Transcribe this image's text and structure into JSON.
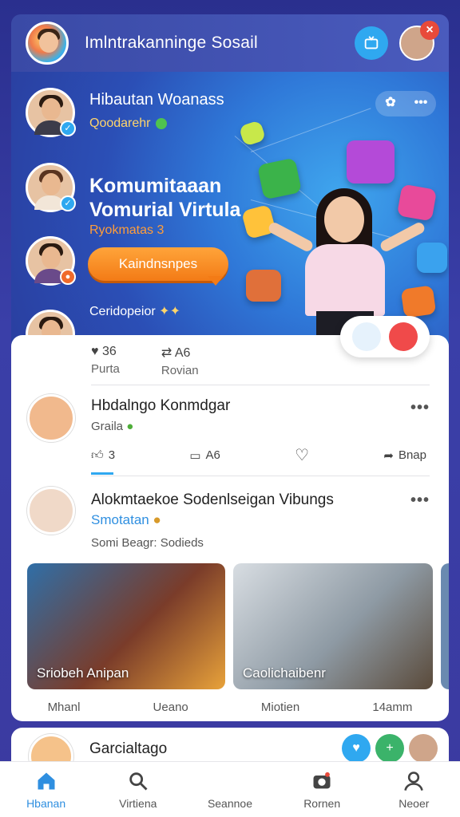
{
  "header": {
    "title": "Imlntrakanninge Sosail",
    "tv_icon": "tv-icon",
    "close_icon": "close-icon"
  },
  "hero": {
    "profile_name": "Hibautan Woanass",
    "profile_sub": "Qoodarehr",
    "heading_line1": "Komumitaaan",
    "heading_line2": "Vomurial Virtula",
    "tagline": "Ryokmatas 3",
    "cta": "Kaindnsnpes",
    "footer": "Ceridopeior",
    "actions_more": "•••"
  },
  "stats": [
    {
      "num": "36",
      "label": "Purta",
      "icon": "heart-icon"
    },
    {
      "num": "A6",
      "label": "Rovian",
      "icon": "share-icon"
    }
  ],
  "post1": {
    "name": "Hbdalngo Konmdgar",
    "sub": "Graila",
    "reactions": [
      {
        "icon": "thumbs-up-icon",
        "label": "3"
      },
      {
        "icon": "comment-icon",
        "label": "A6"
      },
      {
        "icon": "heart-icon",
        "label": ""
      },
      {
        "icon": "share-icon",
        "label": "Bnap"
      }
    ],
    "more": "•••"
  },
  "post2": {
    "name": "Alokmtaekoe Sodenlseigan Vibungs",
    "sub": "Smotatan",
    "meta": "Somi Beagr: Sodieds",
    "more": "•••",
    "photos": [
      {
        "caption": "Sriobeh Anipan"
      },
      {
        "caption": "Caolichaibenr"
      }
    ],
    "photo_labels": [
      "Mhanl",
      "Ueano",
      "Miotien",
      "14amm"
    ]
  },
  "next_post": {
    "name": "Garcialtago"
  },
  "bottom_nav": [
    {
      "label": "Hbanan",
      "icon": "home-icon",
      "active": true
    },
    {
      "label": "Virtiena",
      "icon": "search-icon",
      "active": false
    },
    {
      "label": "Seannoe",
      "icon": "blank-icon",
      "active": false
    },
    {
      "label": "Rornen",
      "icon": "camera-icon",
      "active": false
    },
    {
      "label": "Neoer",
      "icon": "profile-icon",
      "active": false
    }
  ],
  "colors": {
    "accent": "#2fa8f0",
    "cta": "#f37b16",
    "header": "#3a4aa6"
  }
}
